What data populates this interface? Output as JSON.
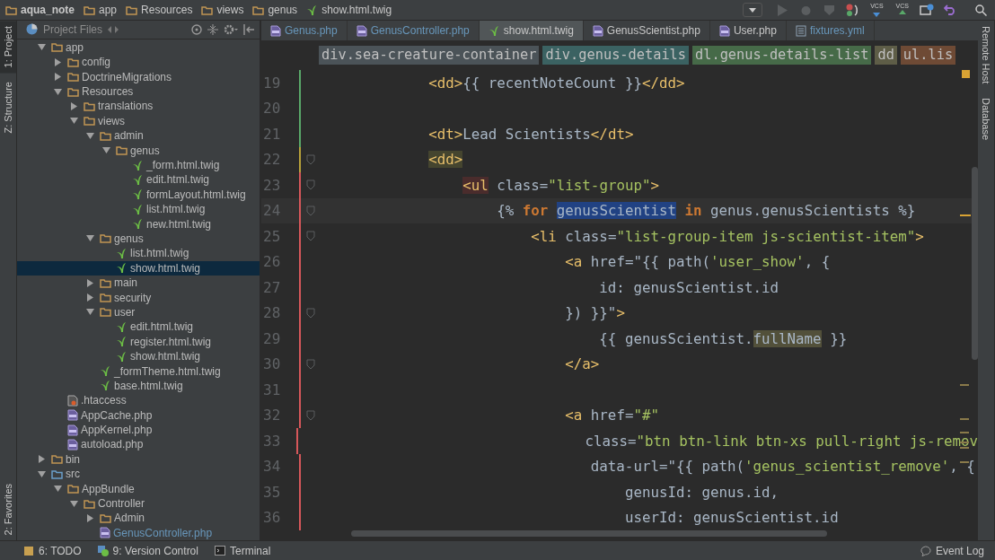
{
  "navbar": {
    "crumbs": [
      {
        "label": "aqua_note",
        "kind": "folder"
      },
      {
        "label": "app",
        "kind": "folder"
      },
      {
        "label": "Resources",
        "kind": "folder"
      },
      {
        "label": "views",
        "kind": "folder"
      },
      {
        "label": "genus",
        "kind": "folder"
      },
      {
        "label": "show.html.twig",
        "kind": "twig"
      }
    ],
    "vcs_buttons": [
      {
        "label": "VCS",
        "kind": "update"
      },
      {
        "label": "VCS",
        "kind": "commit"
      }
    ]
  },
  "left_tool_tabs": [
    {
      "label": "1: Project",
      "selected": true
    },
    {
      "label": "Z: Structure",
      "selected": false
    }
  ],
  "left_bottom_tool_tabs": [
    {
      "label": "2: Favorites",
      "selected": false
    }
  ],
  "right_tool_tabs": [
    {
      "label": "Remote Host"
    },
    {
      "label": "Database"
    }
  ],
  "project_panel": {
    "title": "Project Files"
  },
  "tree": [
    {
      "label": "app",
      "kind": "folder",
      "expanded": true,
      "selected": false,
      "modified": false,
      "children": [
        {
          "label": "config",
          "kind": "folder",
          "expanded": false,
          "selected": false,
          "modified": false
        },
        {
          "label": "DoctrineMigrations",
          "kind": "folder",
          "expanded": false,
          "selected": false,
          "modified": false
        },
        {
          "label": "Resources",
          "kind": "folder",
          "expanded": true,
          "selected": false,
          "modified": false,
          "children": [
            {
              "label": "translations",
              "kind": "folder",
              "expanded": false,
              "selected": false,
              "modified": false
            },
            {
              "label": "views",
              "kind": "folder",
              "expanded": true,
              "selected": false,
              "modified": false,
              "children": [
                {
                  "label": "admin",
                  "kind": "folder",
                  "expanded": true,
                  "selected": false,
                  "modified": false,
                  "children": [
                    {
                      "label": "genus",
                      "kind": "folder",
                      "expanded": true,
                      "selected": false,
                      "modified": false,
                      "children": [
                        {
                          "label": "_form.html.twig",
                          "kind": "twig",
                          "selected": false,
                          "modified": false
                        },
                        {
                          "label": "edit.html.twig",
                          "kind": "twig",
                          "selected": false,
                          "modified": false
                        },
                        {
                          "label": "formLayout.html.twig",
                          "kind": "twig",
                          "selected": false,
                          "modified": false
                        },
                        {
                          "label": "list.html.twig",
                          "kind": "twig",
                          "selected": false,
                          "modified": false
                        },
                        {
                          "label": "new.html.twig",
                          "kind": "twig",
                          "selected": false,
                          "modified": false
                        }
                      ]
                    }
                  ]
                },
                {
                  "label": "genus",
                  "kind": "folder",
                  "expanded": true,
                  "selected": false,
                  "modified": false,
                  "children": [
                    {
                      "label": "list.html.twig",
                      "kind": "twig",
                      "selected": false,
                      "modified": false
                    },
                    {
                      "label": "show.html.twig",
                      "kind": "twig",
                      "selected": true,
                      "modified": false
                    }
                  ]
                },
                {
                  "label": "main",
                  "kind": "folder",
                  "expanded": false,
                  "selected": false,
                  "modified": false
                },
                {
                  "label": "security",
                  "kind": "folder",
                  "expanded": false,
                  "selected": false,
                  "modified": false
                },
                {
                  "label": "user",
                  "kind": "folder",
                  "expanded": true,
                  "selected": false,
                  "modified": false,
                  "children": [
                    {
                      "label": "edit.html.twig",
                      "kind": "twig",
                      "selected": false,
                      "modified": false
                    },
                    {
                      "label": "register.html.twig",
                      "kind": "twig",
                      "selected": false,
                      "modified": false
                    },
                    {
                      "label": "show.html.twig",
                      "kind": "twig",
                      "selected": false,
                      "modified": false
                    }
                  ]
                },
                {
                  "label": "_formTheme.html.twig",
                  "kind": "twig",
                  "selected": false,
                  "modified": false
                },
                {
                  "label": "base.html.twig",
                  "kind": "twig",
                  "selected": false,
                  "modified": false
                }
              ]
            }
          ]
        },
        {
          "label": ".htaccess",
          "kind": "config",
          "selected": false,
          "modified": false
        },
        {
          "label": "AppCache.php",
          "kind": "php",
          "selected": false,
          "modified": false
        },
        {
          "label": "AppKernel.php",
          "kind": "php",
          "selected": false,
          "modified": false
        },
        {
          "label": "autoload.php",
          "kind": "php",
          "selected": false,
          "modified": false
        }
      ]
    },
    {
      "label": "bin",
      "kind": "folder",
      "expanded": false,
      "selected": false,
      "modified": false
    },
    {
      "label": "src",
      "kind": "source",
      "expanded": true,
      "selected": false,
      "modified": false,
      "children": [
        {
          "label": "AppBundle",
          "kind": "folder",
          "expanded": true,
          "selected": false,
          "modified": false,
          "children": [
            {
              "label": "Controller",
              "kind": "folder",
              "expanded": true,
              "selected": false,
              "modified": false,
              "children": [
                {
                  "label": "Admin",
                  "kind": "folder",
                  "expanded": false,
                  "selected": false,
                  "modified": false
                },
                {
                  "label": "GenusController.php",
                  "kind": "php",
                  "selected": false,
                  "modified": true
                }
              ]
            }
          ]
        }
      ]
    }
  ],
  "editor_tabs": [
    {
      "label": "Genus.php",
      "kind": "php",
      "selected": false,
      "modified": true
    },
    {
      "label": "GenusController.php",
      "kind": "php",
      "selected": false,
      "modified": true
    },
    {
      "label": "show.html.twig",
      "kind": "twig",
      "selected": true,
      "modified": false
    },
    {
      "label": "GenusScientist.php",
      "kind": "php",
      "selected": false,
      "modified": false
    },
    {
      "label": "User.php",
      "kind": "php",
      "selected": false,
      "modified": false
    },
    {
      "label": "fixtures.yml",
      "kind": "yml",
      "selected": false,
      "modified": true
    }
  ],
  "tag_path": [
    {
      "label": "div.sea-creature-container",
      "color": "#4b5358"
    },
    {
      "label": "div.genus-details",
      "color": "#3b6262"
    },
    {
      "label": "dl.genus-details-list",
      "color": "#466a48"
    },
    {
      "label": "dd",
      "color": "#5e5d47"
    },
    {
      "label": "ul.lis",
      "color": "#6e4a35"
    }
  ],
  "code_lines": [
    {
      "number": "19",
      "kind": "added",
      "fold": false,
      "current": false,
      "tokens": [
        {
          "t": "            <dd>",
          "kind": "tag"
        },
        {
          "t": "{{ recentNoteCount }}",
          "kind": "text"
        },
        {
          "t": "</dd>",
          "kind": "tag"
        }
      ]
    },
    {
      "number": "20",
      "kind": "added",
      "fold": false,
      "current": false
    },
    {
      "number": "21",
      "kind": "added",
      "fold": false,
      "current": false,
      "tokens": [
        {
          "t": "            <dt>",
          "kind": "tag"
        },
        {
          "t": "Lead Scientists",
          "kind": "text"
        },
        {
          "t": "</dt>",
          "kind": "tag"
        }
      ]
    },
    {
      "number": "22",
      "kind": "modified",
      "fold": true,
      "current": false,
      "tokens": [
        {
          "t": "            <dd>",
          "kind": "tag-brace"
        }
      ]
    },
    {
      "number": "23",
      "kind": "removed",
      "fold": true,
      "current": false,
      "tokens": [
        {
          "t": "                <ul",
          "kind": "tag-error"
        },
        {
          "t": " class=",
          "kind": "text"
        },
        {
          "t": "\"list-group\"",
          "kind": "str"
        },
        {
          "t": ">",
          "kind": "tag"
        }
      ]
    },
    {
      "number": "24",
      "kind": "removed",
      "fold": true,
      "current": true,
      "tokens": [
        {
          "t": "                    {% ",
          "kind": "text"
        },
        {
          "t": "for",
          "kind": "kw"
        },
        {
          "t": " genusScientist",
          "kind": "text-selection"
        },
        {
          "t": " in",
          "kind": "kw"
        },
        {
          "t": " genus.genusScientists %}",
          "kind": "text"
        }
      ]
    },
    {
      "number": "25",
      "kind": "removed",
      "fold": true,
      "current": false,
      "tokens": [
        {
          "t": "                        <li",
          "kind": "tag"
        },
        {
          "t": " class=",
          "kind": "text"
        },
        {
          "t": "\"list-group-item js-scientist-item\"",
          "kind": "str"
        },
        {
          "t": ">",
          "kind": "tag"
        }
      ]
    },
    {
      "number": "26",
      "kind": "removed",
      "fold": false,
      "current": false,
      "tokens": [
        {
          "t": "                            <a",
          "kind": "tag"
        },
        {
          "t": " href=\"{{ path(",
          "kind": "text"
        },
        {
          "t": "'user_show'",
          "kind": "str"
        },
        {
          "t": ", {",
          "kind": "text"
        }
      ]
    },
    {
      "number": "27",
      "kind": "removed",
      "fold": false,
      "current": false,
      "tokens": [
        {
          "t": "                                id: genusScientist.id",
          "kind": "text"
        }
      ]
    },
    {
      "number": "28",
      "kind": "removed",
      "fold": true,
      "current": false,
      "tokens": [
        {
          "t": "                            }) }}\"",
          "kind": "text"
        },
        {
          "t": ">",
          "kind": "tag"
        }
      ]
    },
    {
      "number": "29",
      "kind": "removed",
      "fold": false,
      "current": false,
      "tokens": [
        {
          "t": "                                {{ genusScientist.",
          "kind": "text"
        },
        {
          "t": "fullName",
          "kind": "text-match"
        },
        {
          "t": " }}",
          "kind": "text"
        }
      ]
    },
    {
      "number": "30",
      "kind": "removed",
      "fold": true,
      "current": false,
      "tokens": [
        {
          "t": "                            </a>",
          "kind": "tag"
        }
      ]
    },
    {
      "number": "31",
      "kind": "removed",
      "fold": false,
      "current": false
    },
    {
      "number": "32",
      "kind": "removed",
      "fold": true,
      "current": false,
      "tokens": [
        {
          "t": "                            <a",
          "kind": "tag"
        },
        {
          "t": " href=",
          "kind": "text"
        },
        {
          "t": "\"#\"",
          "kind": "str"
        }
      ]
    },
    {
      "number": "33",
      "kind": "removed",
      "fold": false,
      "current": false,
      "tokens": [
        {
          "t": "                               class=",
          "kind": "text"
        },
        {
          "t": "\"btn btn-link btn-xs pull-right js-remov",
          "kind": "str"
        }
      ]
    },
    {
      "number": "34",
      "kind": "removed",
      "fold": false,
      "current": false,
      "tokens": [
        {
          "t": "                               data-url=\"{{ path(",
          "kind": "text"
        },
        {
          "t": "'genus_scientist_remove'",
          "kind": "str"
        },
        {
          "t": ", {",
          "kind": "text"
        }
      ]
    },
    {
      "number": "35",
      "kind": "removed",
      "fold": false,
      "current": false,
      "tokens": [
        {
          "t": "                                   genusId: genus.id,",
          "kind": "text"
        }
      ]
    },
    {
      "number": "36",
      "kind": "removed",
      "fold": false,
      "current": false,
      "tokens": [
        {
          "t": "                                   userId: genusScientist.id",
          "kind": "text"
        }
      ]
    }
  ],
  "status_bar": {
    "tools": [
      {
        "label": "6: TODO",
        "kind": "todo"
      },
      {
        "label": "9: Version Control",
        "kind": "vcs"
      },
      {
        "label": "Terminal",
        "kind": "terminal"
      }
    ],
    "event_log": "Event Log"
  }
}
